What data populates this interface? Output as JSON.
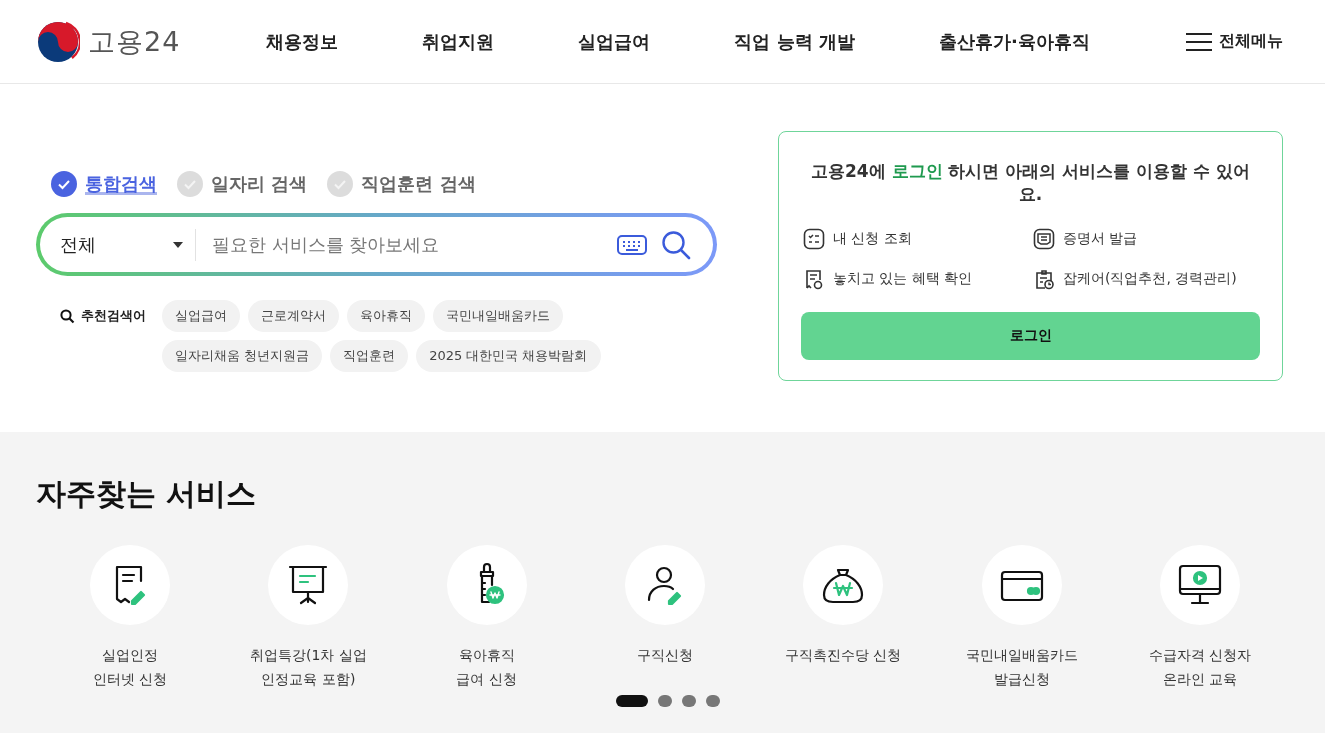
{
  "header": {
    "logo_text": "고용24",
    "nav": [
      "채용정보",
      "취업지원",
      "실업급여",
      "직업 능력 개발",
      "출산휴가·육아휴직"
    ],
    "menu_label": "전체메뉴"
  },
  "search": {
    "tabs": [
      {
        "label": "통합검색",
        "selected": true
      },
      {
        "label": "일자리 검색",
        "selected": false
      },
      {
        "label": "직업훈련 검색",
        "selected": false
      }
    ],
    "category": "전체",
    "placeholder": "필요한 서비스를 찾아보세요",
    "recommended_label": "추천검색어",
    "keywords": [
      "실업급여",
      "근로계약서",
      "육아휴직",
      "국민내일배움카드",
      "일자리채움 청년지원금",
      "직업훈련",
      "2025 대한민국 채용박람회"
    ]
  },
  "login_card": {
    "message_prefix": "고용24에 ",
    "message_highlight": "로그인",
    "message_suffix": " 하시면 아래의 서비스를 이용할 수 있어요.",
    "services": [
      {
        "kind": "list",
        "label": "내 신청 조회"
      },
      {
        "kind": "certificate",
        "label": "증명서 발급"
      },
      {
        "kind": "benefit",
        "label": "놓치고 있는 혜택 확인"
      },
      {
        "kind": "jobcare",
        "label": "잡케어(직업추천, 경력관리)"
      }
    ],
    "button": "로그인"
  },
  "frequent": {
    "title": "자주찾는 서비스",
    "items": [
      {
        "kind": "document",
        "lines": [
          "실업인정",
          "인터넷 신청"
        ]
      },
      {
        "kind": "presentation",
        "lines": [
          "취업특강(1차 실업",
          "인정교육 포함)"
        ]
      },
      {
        "kind": "bottle",
        "lines": [
          "육아휴직",
          "급여 신청"
        ]
      },
      {
        "kind": "person",
        "lines": [
          "구직신청"
        ]
      },
      {
        "kind": "moneybag",
        "lines": [
          "구직촉진수당 신청"
        ]
      },
      {
        "kind": "card",
        "lines": [
          "국민내일배움카드",
          "발급신청"
        ]
      },
      {
        "kind": "monitor",
        "lines": [
          "수급자격 신청자",
          "온라인 교육"
        ]
      }
    ],
    "pages": [
      {
        "selected": true
      },
      {
        "selected": false
      },
      {
        "selected": false
      },
      {
        "selected": false
      }
    ]
  }
}
